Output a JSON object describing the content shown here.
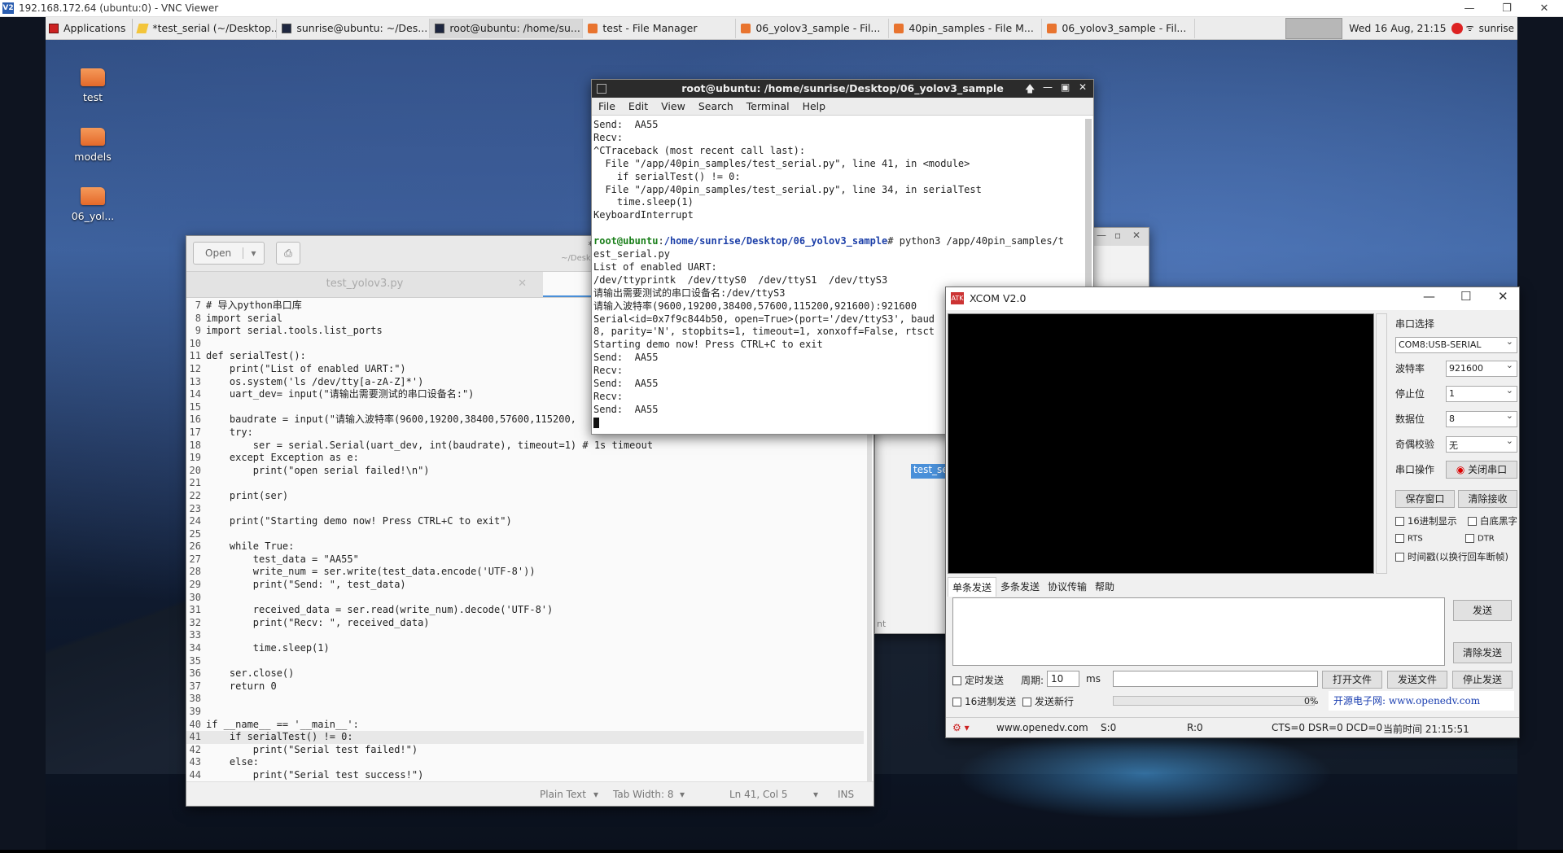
{
  "vnc": {
    "title": "192.168.172.64 (ubuntu:0) - VNC Viewer",
    "logo": "V2"
  },
  "panel": {
    "apps_label": "Applications",
    "tasks": [
      {
        "label": "*test_serial (~/Desktop...",
        "icon": "editor-icon"
      },
      {
        "label": "sunrise@ubuntu: ~/Des...",
        "icon": "terminal-icon"
      },
      {
        "label": "root@ubuntu: /home/su...",
        "icon": "terminal-icon"
      },
      {
        "label": "test - File Manager",
        "icon": "folder-icon"
      },
      {
        "label": "06_yolov3_sample - Fil...",
        "icon": "folder-icon"
      },
      {
        "label": "40pin_samples - File M...",
        "icon": "folder-icon"
      },
      {
        "label": "06_yolov3_sample - Fil...",
        "icon": "folder-icon"
      }
    ],
    "clock": "Wed 16 Aug, 21:15",
    "user": "sunrise"
  },
  "desktop": {
    "icons": [
      "test",
      "models",
      "06_yol..."
    ]
  },
  "editor": {
    "open_label": "Open",
    "title": "*test_serial",
    "subtitle": "~/Desktop/06_yolov3_samp",
    "tab_inactive": "test_yolov3.py",
    "lines": [
      {
        "n": "7",
        "t": "# 导入python串口库"
      },
      {
        "n": "8",
        "t": "import serial"
      },
      {
        "n": "9",
        "t": "import serial.tools.list_ports"
      },
      {
        "n": "10",
        "t": ""
      },
      {
        "n": "11",
        "t": "def serialTest():"
      },
      {
        "n": "12",
        "t": "    print(\"List of enabled UART:\")"
      },
      {
        "n": "13",
        "t": "    os.system('ls /dev/tty[a-zA-Z]*')"
      },
      {
        "n": "14",
        "t": "    uart_dev= input(\"请输出需要测试的串口设备名:\")"
      },
      {
        "n": "15",
        "t": ""
      },
      {
        "n": "16",
        "t": "    baudrate = input(\"请输入波特率(9600,19200,38400,57600,115200,"
      },
      {
        "n": "17",
        "t": "    try:"
      },
      {
        "n": "18",
        "t": "        ser = serial.Serial(uart_dev, int(baudrate), timeout=1) # 1s timeout"
      },
      {
        "n": "19",
        "t": "    except Exception as e:"
      },
      {
        "n": "20",
        "t": "        print(\"open serial failed!\\n\")"
      },
      {
        "n": "21",
        "t": ""
      },
      {
        "n": "22",
        "t": "    print(ser)"
      },
      {
        "n": "23",
        "t": ""
      },
      {
        "n": "24",
        "t": "    print(\"Starting demo now! Press CTRL+C to exit\")"
      },
      {
        "n": "25",
        "t": ""
      },
      {
        "n": "26",
        "t": "    while True:"
      },
      {
        "n": "27",
        "t": "        test_data = \"AA55\""
      },
      {
        "n": "28",
        "t": "        write_num = ser.write(test_data.encode('UTF-8'))"
      },
      {
        "n": "29",
        "t": "        print(\"Send: \", test_data)"
      },
      {
        "n": "30",
        "t": ""
      },
      {
        "n": "31",
        "t": "        received_data = ser.read(write_num).decode('UTF-8')"
      },
      {
        "n": "32",
        "t": "        print(\"Recv: \", received_data)"
      },
      {
        "n": "33",
        "t": ""
      },
      {
        "n": "34",
        "t": "        time.sleep(1)"
      },
      {
        "n": "35",
        "t": ""
      },
      {
        "n": "36",
        "t": "    ser.close()"
      },
      {
        "n": "37",
        "t": "    return 0"
      },
      {
        "n": "38",
        "t": ""
      },
      {
        "n": "39",
        "t": ""
      },
      {
        "n": "40",
        "t": "if __name__ == '__main__':"
      },
      {
        "n": "41",
        "t": "    if serialTest() != 0:"
      },
      {
        "n": "42",
        "t": "        print(\"Serial test failed!\")"
      },
      {
        "n": "43",
        "t": "    else:"
      },
      {
        "n": "44",
        "t": "        print(\"Serial test success!\")"
      }
    ],
    "current_line": "41",
    "status": {
      "lang": "Plain Text",
      "tab": "Tab Width: 8",
      "pos": "Ln 41, Col 5",
      "ins": "INS"
    }
  },
  "fm_back": {
    "selected": "test_se",
    "status": "nt"
  },
  "terminal": {
    "title": "root@ubuntu: /home/sunrise/Desktop/06_yolov3_sample",
    "menu": [
      "File",
      "Edit",
      "View",
      "Search",
      "Terminal",
      "Help"
    ],
    "lines_top": [
      "Send:  AA55",
      "Recv:",
      "^CTraceback (most recent call last):",
      "  File \"/app/40pin_samples/test_serial.py\", line 41, in <module>",
      "    if serialTest() != 0:",
      "  File \"/app/40pin_samples/test_serial.py\", line 34, in serialTest",
      "    time.sleep(1)",
      "KeyboardInterrupt",
      ""
    ],
    "prompt_user": "root@ubuntu",
    "prompt_path": "/home/sunrise/Desktop/06_yolov3_sample",
    "command": "# python3 /app/40pin_samples/t",
    "lines_bottom": [
      "est_serial.py",
      "List of enabled UART:",
      "/dev/ttyprintk  /dev/ttyS0  /dev/ttyS1  /dev/ttyS3",
      "请输出需要测试的串口设备名:/dev/ttyS3",
      "请输入波特率(9600,19200,38400,57600,115200,921600):921600",
      "Serial<id=0x7f9c844b50, open=True>(port='/dev/ttyS3', baud",
      "8, parity='N', stopbits=1, timeout=1, xonxoff=False, rtsct",
      "Starting demo now! Press CTRL+C to exit",
      "Send:  AA55",
      "Recv:",
      "Send:  AA55",
      "Recv:",
      "Send:  AA55"
    ]
  },
  "xcom": {
    "title": "XCOM V2.0",
    "icon": "ATK",
    "port_label": "串口选择",
    "port": "COM8:USB-SERIAL",
    "fields": [
      {
        "label": "波特率",
        "value": "921600"
      },
      {
        "label": "停止位",
        "value": "1"
      },
      {
        "label": "数据位",
        "value": "8"
      },
      {
        "label": "奇偶校验",
        "value": "无"
      }
    ],
    "op_label": "串口操作",
    "close_port": "关闭串口",
    "save_window": "保存窗口",
    "clear_recv": "清除接收",
    "hex_display": "16进制显示",
    "white_bg": "白底黑字",
    "rts": "RTS",
    "dtr": "DTR",
    "timestamp": "时间戳(以换行回车断帧)",
    "tabs": [
      "单条发送",
      "多条发送",
      "协议传输",
      "帮助"
    ],
    "send": "发送",
    "clear_send": "清除发送",
    "timed_send": "定时发送",
    "period_label": "周期:",
    "period": "10",
    "ms": "ms",
    "open_file": "打开文件",
    "send_file": "发送文件",
    "stop_send": "停止发送",
    "hex_send": "16进制发送",
    "send_newline": "发送新行",
    "progress": "0%",
    "site_link": "开源电子网: www.openedv.com",
    "status": {
      "site": "www.openedv.com",
      "s": "S:0",
      "r": "R:0",
      "lines": "CTS=0 DSR=0 DCD=0",
      "time": "当前时间 21:15:51"
    }
  }
}
